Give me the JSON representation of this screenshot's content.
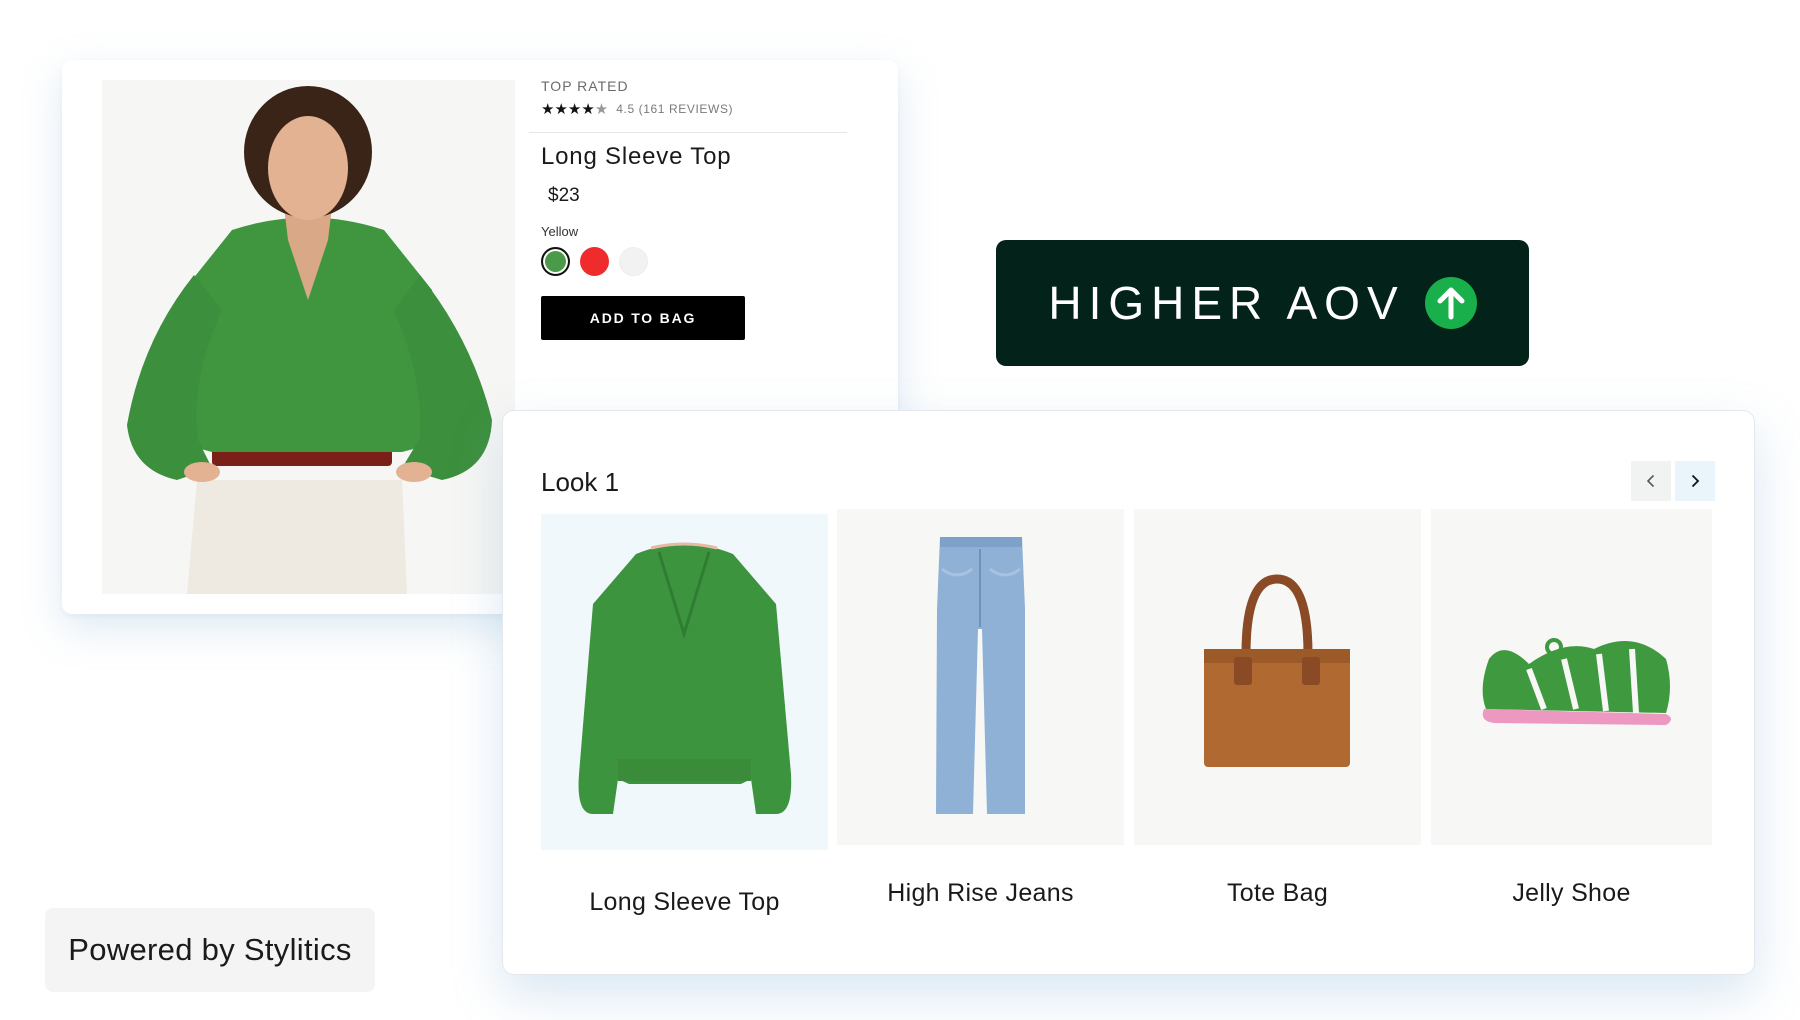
{
  "product": {
    "eyebrow": "TOP RATED",
    "stars": "★★★★",
    "star_half": "★",
    "rating_text": "4.5 (161 REVIEWS)",
    "name": "Long Sleeve Top",
    "price": "$23",
    "color_label": "Yellow",
    "swatches": [
      {
        "color": "#4a9a49",
        "selected": true
      },
      {
        "color": "#ef2b2b",
        "selected": false
      },
      {
        "color": "#f2f2f2",
        "selected": false
      }
    ],
    "add_to_bag": "ADD TO BAG"
  },
  "badge": {
    "text": "HIGHER AOV",
    "background": "#03231a",
    "arrow_color": "#19b04b",
    "icon": "arrow-up-circle-icon"
  },
  "look": {
    "title": "Look 1",
    "prev_icon": "chevron-left-icon",
    "next_icon": "chevron-right-icon",
    "items": [
      {
        "name": "Long Sleeve Top",
        "icon": "green-top-image",
        "selected": true
      },
      {
        "name": "High Rise Jeans",
        "icon": "jeans-image",
        "selected": false
      },
      {
        "name": "Tote Bag",
        "icon": "tote-bag-image",
        "selected": false
      },
      {
        "name": "Jelly Shoe",
        "icon": "jelly-shoe-image",
        "selected": false
      }
    ]
  },
  "footer": {
    "powered_by": "Powered by Stylitics"
  },
  "colors": {
    "green": "#3f963f",
    "shadow_blue": "#78aad2"
  }
}
